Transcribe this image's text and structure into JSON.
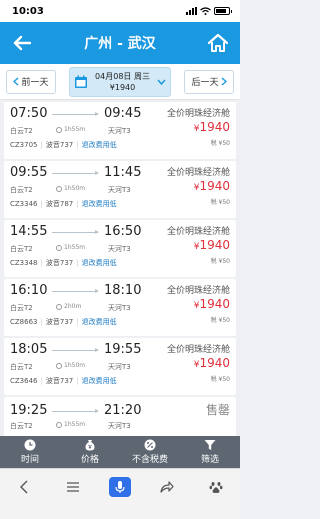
{
  "status_bar": {
    "time": "10:03"
  },
  "header": {
    "title": "广州 - 武汉"
  },
  "date_bar": {
    "prev_label": "前一天",
    "current_date": "04月08日 周三",
    "current_price": "¥1940",
    "next_label": "后一天"
  },
  "flights": [
    {
      "dep_time": "07:50",
      "arr_time": "09:45",
      "dep_airport": "白云T2",
      "arr_airport": "天河T3",
      "duration": "1h55m",
      "flight_no": "CZ3705",
      "aircraft": "波音737",
      "refund": "退改费用低",
      "cabin": "全价明珠经济舱",
      "price": "1940",
      "tax": "税 ¥50"
    },
    {
      "dep_time": "09:55",
      "arr_time": "11:45",
      "dep_airport": "白云T2",
      "arr_airport": "天河T3",
      "duration": "1h50m",
      "flight_no": "CZ3346",
      "aircraft": "波音787",
      "refund": "退改费用低",
      "cabin": "全价明珠经济舱",
      "price": "1940",
      "tax": "税 ¥50"
    },
    {
      "dep_time": "14:55",
      "arr_time": "16:50",
      "dep_airport": "白云T2",
      "arr_airport": "天河T3",
      "duration": "1h55m",
      "flight_no": "CZ3348",
      "aircraft": "波音737",
      "refund": "退改费用低",
      "cabin": "全价明珠经济舱",
      "price": "1940",
      "tax": "税 ¥50"
    },
    {
      "dep_time": "16:10",
      "arr_time": "18:10",
      "dep_airport": "白云T2",
      "arr_airport": "天河T3",
      "duration": "2h0m",
      "flight_no": "CZ8663",
      "aircraft": "波音737",
      "refund": "退改费用低",
      "cabin": "全价明珠经济舱",
      "price": "1940",
      "tax": "税 ¥50"
    },
    {
      "dep_time": "18:05",
      "arr_time": "19:55",
      "dep_airport": "白云T2",
      "arr_airport": "天河T3",
      "duration": "1h50m",
      "flight_no": "CZ3646",
      "aircraft": "波音737",
      "refund": "退改费用低",
      "cabin": "全价明珠经济舱",
      "price": "1940",
      "tax": "税 ¥50"
    }
  ],
  "partial_flight": {
    "dep_time": "19:25",
    "arr_time": "21:20",
    "dep_airport": "白云T2",
    "arr_airport": "天河T3",
    "duration": "1h55m",
    "status": "售罄"
  },
  "currency_symbol": "¥",
  "filter_bar": {
    "time": "时间",
    "price": "价格",
    "no_tax": "不含税费",
    "filter": "筛选"
  },
  "colors": {
    "brand": "#1a98e0",
    "price": "#e0303c",
    "filter_bar": "#5d6671",
    "voice_button": "#2f6fe8"
  },
  "icons": [
    "back-arrow-icon",
    "home-icon",
    "calendar-icon",
    "chevron-down-icon",
    "clock-icon",
    "money-bag-icon",
    "percent-icon",
    "funnel-icon",
    "menu-icon",
    "microphone-icon",
    "share-icon",
    "paw-icon"
  ]
}
